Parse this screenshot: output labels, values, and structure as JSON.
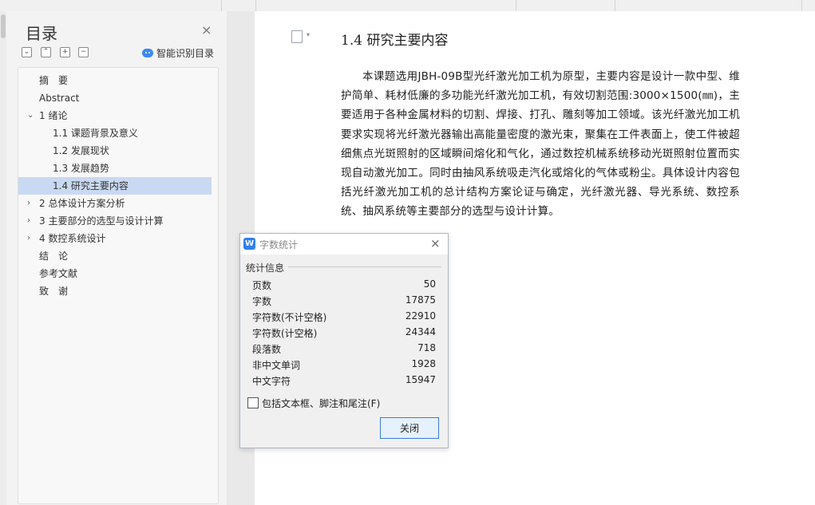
{
  "sidebar": {
    "title": "目录",
    "close_glyph": "×",
    "toolbar": {
      "collapse_glyph": "⌄",
      "expand_glyph": "⌃",
      "add_glyph": "+",
      "remove_glyph": "−"
    },
    "ai_button_label": "智能识别目录",
    "items": [
      {
        "label": "摘　要",
        "level": 0,
        "chevron": ""
      },
      {
        "label": "Abstract",
        "level": 0,
        "chevron": ""
      },
      {
        "label": "1 绪论",
        "level": 0,
        "chevron": "⌄"
      },
      {
        "label": "1.1 课题背景及意义",
        "level": 1,
        "chevron": ""
      },
      {
        "label": "1.2 发展现状",
        "level": 1,
        "chevron": ""
      },
      {
        "label": "1.3 发展趋势",
        "level": 1,
        "chevron": ""
      },
      {
        "label": "1.4 研究主要内容",
        "level": 1,
        "chevron": "",
        "selected": true
      },
      {
        "label": "2 总体设计方案分析",
        "level": 0,
        "chevron": "›"
      },
      {
        "label": "3 主要部分的选型与设计计算",
        "level": 0,
        "chevron": "›"
      },
      {
        "label": "4 数控系统设计",
        "level": 0,
        "chevron": "›"
      },
      {
        "label": "结　论",
        "level": 0,
        "chevron": ""
      },
      {
        "label": "参考文献",
        "level": 0,
        "chevron": ""
      },
      {
        "label": "致　谢",
        "level": 0,
        "chevron": ""
      }
    ]
  },
  "document": {
    "icon_caret": "▾",
    "heading": "1.4 研究主要内容",
    "paragraph": "本课题选用JBH-09B型光纤激光加工机为原型，主要内容是设计一款中型、维护简单、耗材低廉的多功能光纤激光加工机，有效切割范围:3000×1500(㎜)，主要适用于各种金属材料的切割、焊接、打孔、雕刻等加工领域。该光纤激光加工机要求实现将光纤激光器输出高能量密度的激光束，聚集在工件表面上，使工件被超细焦点光斑照射的区域瞬间熔化和气化，通过数控机械系统移动光斑照射位置而实现自动激光加工。同时由抽风系统吸走汽化或熔化的气体或粉尘。具体设计内容包括光纤激光加工机的总计结构方案论证与确定，光纤激光器、导光系统、数控系统、抽风系统等主要部分的选型与设计计算。"
  },
  "dialog": {
    "app_icon_glyph": "W",
    "title": "字数统计",
    "close_glyph": "×",
    "section_label": "统计信息",
    "stats": [
      {
        "label": "页数",
        "value": "50"
      },
      {
        "label": "字数",
        "value": "17875"
      },
      {
        "label": "字符数(不计空格)",
        "value": "22910"
      },
      {
        "label": "字符数(计空格)",
        "value": "24344"
      },
      {
        "label": "段落数",
        "value": "718"
      },
      {
        "label": "非中文单词",
        "value": "1928"
      },
      {
        "label": "中文字符",
        "value": "15947"
      }
    ],
    "checkbox_label": "包括文本框、脚注和尾注(F)",
    "checkbox_checked": false,
    "close_button_label": "关闭"
  },
  "colors": {
    "selected_item": "#c9d9f2",
    "accent": "#2f7ff0",
    "button_border": "#3a7bd5"
  }
}
